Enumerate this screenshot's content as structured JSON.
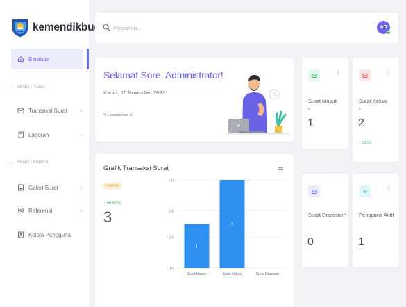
{
  "brand": {
    "name": "kemendikbud"
  },
  "sidebar": {
    "active": {
      "label": "Beranda",
      "icon": "home-icon"
    },
    "sections": [
      {
        "title": "MENU UTAMA",
        "items": [
          {
            "label": "Transaksi Surat",
            "icon": "mail-icon",
            "has_chevron": true
          },
          {
            "label": "Laporan",
            "icon": "document-icon",
            "has_chevron": true
          }
        ]
      },
      {
        "title": "MENU LAINNYA",
        "items": [
          {
            "label": "Galeri Surat",
            "icon": "image-icon",
            "has_chevron": true
          },
          {
            "label": "Referensi",
            "icon": "settings-icon",
            "has_chevron": true
          },
          {
            "label": "Kelola Pengguna",
            "icon": "user-manage-icon",
            "has_chevron": false
          }
        ]
      }
    ]
  },
  "search": {
    "placeholder": "Pencarian..."
  },
  "user": {
    "initials": "AD",
    "online_color": "#53c95a"
  },
  "welcome": {
    "title": "Selamat Sore, Administrator!",
    "date": "Kamis, 16 November 2023",
    "note": "*) Laporan hari ini"
  },
  "stats": {
    "surat_masuk": {
      "title": "Surat Masuk",
      "suffix": "*",
      "value": "1",
      "icon": "inbox-icon",
      "icon_color": "#3fbd6b",
      "icon_bg": "#e3f7ea"
    },
    "surat_keluar": {
      "title": "Surat Keluar",
      "suffix": "*",
      "value": "2",
      "delta": "↑ 100%",
      "icon": "outbox-icon",
      "icon_color": "#ef5b60",
      "icon_bg": "#fde6e7"
    },
    "surat_disposisi": {
      "title": "Surat Disposisi",
      "suffix": "*",
      "value": "0",
      "icon": "disposition-icon",
      "icon_color": "#6c74ee",
      "icon_bg": "#e9eafd"
    },
    "pengguna_aktif": {
      "title": "Pengguna Aktif",
      "value": "1",
      "icon": "activity-icon",
      "icon_color": "#2ab9d9",
      "icon_bg": "#e0f6fb"
    }
  },
  "chart_card": {
    "title": "Grafik Transaksi Surat",
    "badge": "HARI INI",
    "delta": "↑ 66.67%",
    "total": "3"
  },
  "chart_data": {
    "type": "bar",
    "categories": [
      "Surat Masuk",
      "Surat Keluar",
      "Surat Disposisi"
    ],
    "values": [
      1,
      2,
      0
    ],
    "data_labels": [
      "1",
      "2",
      ""
    ],
    "yticks": [
      "0.0",
      "0.7",
      "1.3",
      "2.0"
    ],
    "ylim": [
      0,
      2
    ],
    "grid": true,
    "bar_color": "#2f8ff0"
  },
  "colors": {
    "accent": "#6b64e6",
    "positive": "#4cc36c"
  }
}
